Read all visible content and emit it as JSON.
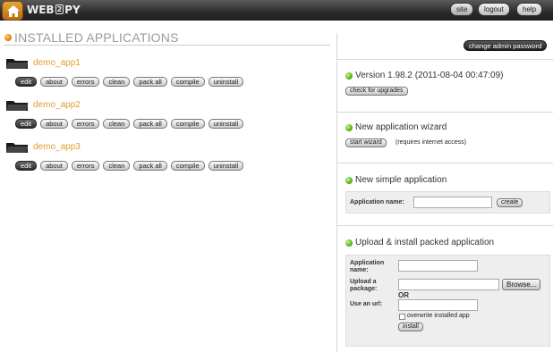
{
  "header": {
    "logo_prefix": "WEB",
    "logo_two": "2",
    "logo_suffix": "PY",
    "buttons": [
      "site",
      "logout",
      "help"
    ]
  },
  "left": {
    "title": "INSTALLED APPLICATIONS",
    "apps": [
      {
        "name": "demo_app1"
      },
      {
        "name": "demo_app2"
      },
      {
        "name": "demo_app3"
      }
    ],
    "actions": [
      "edit",
      "about",
      "errors",
      "clean",
      "pack all",
      "compile",
      "uninstall"
    ]
  },
  "right": {
    "admin_button": "change admin password",
    "version": {
      "title": "Version 1.98.2 (2011-08-04 00:47:09)",
      "button": "check for upgrades"
    },
    "wizard": {
      "title": "New application wizard",
      "button": "start wizard",
      "note": "(requires internet access)"
    },
    "simple": {
      "title": "New simple application",
      "label": "Application name:",
      "button": "create"
    },
    "upload": {
      "title": "Upload & install packed application",
      "name_label_1": "Application",
      "name_label_2": "name:",
      "package_label_1": "Upload a",
      "package_label_2": "package:",
      "browse": "Browse...",
      "or": "OR",
      "url_label": "Use an url:",
      "overwrite": "overwrite installed app",
      "install": "install"
    }
  },
  "colors": {
    "accent_orange": "#e59a2c",
    "green_dot": "#49a800",
    "header_bg": "#2b2b2b"
  }
}
